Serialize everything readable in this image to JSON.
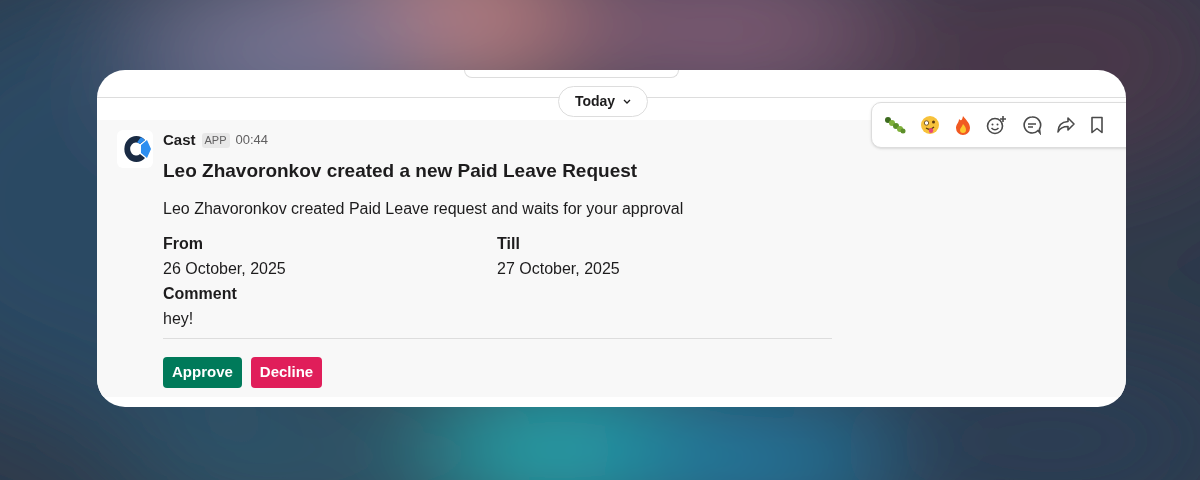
{
  "date_divider": {
    "label": "Today"
  },
  "message": {
    "sender": "Cast",
    "badge": "APP",
    "time": "00:44",
    "title": "Leo Zhavoronkov created a new Paid Leave Request",
    "body": "Leo Zhavoronkov created Paid Leave request and waits for your approval",
    "fields": [
      {
        "label": "From",
        "value": "26 October, 2025"
      },
      {
        "label": "Till",
        "value": "27 October, 2025"
      },
      {
        "label": "Comment",
        "value": "hey!"
      }
    ],
    "buttons": [
      {
        "label": "Approve",
        "kind": "primary"
      },
      {
        "label": "Decline",
        "kind": "danger"
      }
    ]
  }
}
